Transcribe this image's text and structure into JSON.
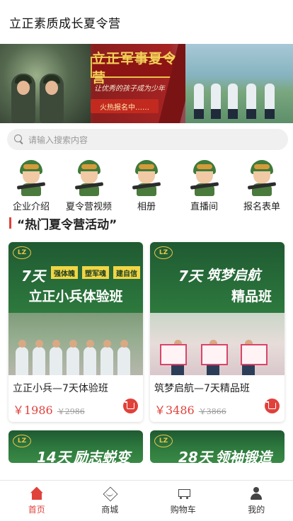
{
  "header": {
    "title": "立正素质成长夏令营"
  },
  "banner": {
    "slogan": "立正军事夏令营",
    "subtitle": "让优秀的孩子成为少年",
    "cta": "火热报名中……"
  },
  "search": {
    "placeholder": "请输入搜索内容"
  },
  "categories": [
    {
      "label": "企业介绍",
      "icon": "soldier-avatar-icon"
    },
    {
      "label": "夏令营视频",
      "icon": "soldier-avatar-icon"
    },
    {
      "label": "相册",
      "icon": "soldier-avatar-icon"
    },
    {
      "label": "直播间",
      "icon": "soldier-avatar-icon"
    },
    {
      "label": "报名表单",
      "icon": "soldier-avatar-icon"
    }
  ],
  "section": {
    "title": "“热门夏令营活动”"
  },
  "products": [
    {
      "logo": "LZ",
      "poster_days": "7天",
      "poster_tags": [
        "强体魄",
        "塑军魂",
        "建自信"
      ],
      "poster_name": "立正小兵体验班",
      "name": "立正小兵—7天体验班",
      "price": "￥1986",
      "old_price": "￥2986"
    },
    {
      "logo": "LZ",
      "poster_days": "7天",
      "poster_title": "筑梦启航",
      "poster_name": "精品班",
      "name": "筑梦启航—7天精品班",
      "price": "￥3486",
      "old_price": "￥3866"
    },
    {
      "logo": "LZ",
      "poster_days": "14天",
      "poster_name": "励志蜕变"
    },
    {
      "logo": "LZ",
      "poster_days": "28天",
      "poster_name": "领袖锻造"
    }
  ],
  "tabbar": [
    {
      "label": "首页",
      "icon": "home-icon",
      "active": true
    },
    {
      "label": "商城",
      "icon": "mall-icon",
      "active": false
    },
    {
      "label": "购物车",
      "icon": "cart-icon",
      "active": false
    },
    {
      "label": "我的",
      "icon": "user-icon",
      "active": false
    }
  ],
  "colors": {
    "accent": "#e0413b",
    "banner_red": "#a62323",
    "poster_green": "#2e7a3e"
  }
}
